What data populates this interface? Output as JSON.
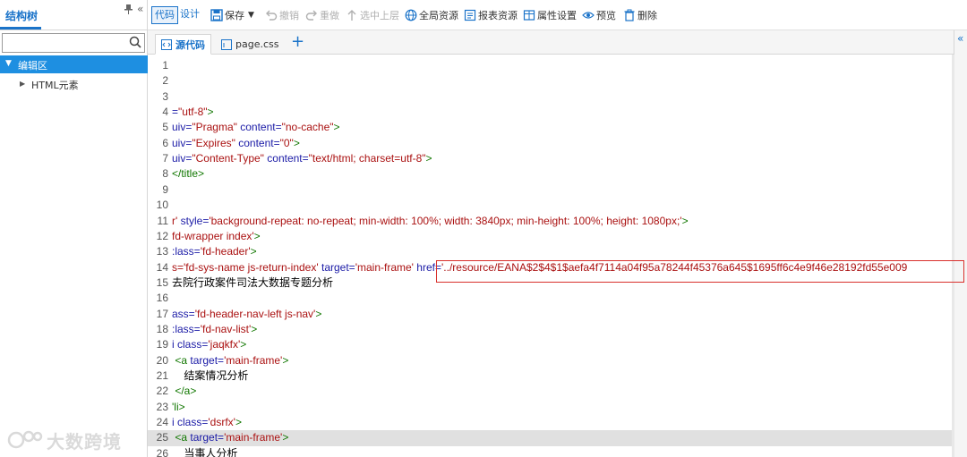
{
  "left_panel": {
    "title": "结构树",
    "pin_icon": "pin-icon",
    "collapse_icon": "double-chevron-left-icon",
    "search": {
      "value": "",
      "placeholder": ""
    },
    "tree": {
      "root": "编辑区",
      "child": "HTML元素"
    }
  },
  "toolbar": {
    "mode_code": "代码",
    "mode_design": "设计",
    "save": "保存",
    "undo": "撤销",
    "redo": "重做",
    "select_parent": "选中上层",
    "global_resources": "全局资源",
    "report_resources": "报表资源",
    "property_settings": "属性设置",
    "preview": "预览",
    "delete": "删除"
  },
  "tabs": [
    {
      "label": "源代码",
      "active": true
    },
    {
      "label": "page.css",
      "active": false
    }
  ],
  "editor": {
    "highlighted_line": 25,
    "lines": [
      {
        "n": "1",
        "segs": []
      },
      {
        "n": "2",
        "segs": []
      },
      {
        "n": "3",
        "segs": []
      },
      {
        "n": "4",
        "segs": [
          [
            "attr",
            "="
          ],
          [
            "str",
            "\"utf-8\""
          ],
          [
            "tag",
            ">"
          ]
        ]
      },
      {
        "n": "5",
        "segs": [
          [
            "attr",
            "uiv="
          ],
          [
            "str",
            "\"Pragma\""
          ],
          [
            "plain",
            " "
          ],
          [
            "attr",
            "content="
          ],
          [
            "str",
            "\"no-cache\""
          ],
          [
            "tag",
            ">"
          ]
        ]
      },
      {
        "n": "6",
        "segs": [
          [
            "attr",
            "uiv="
          ],
          [
            "str",
            "\"Expires\""
          ],
          [
            "plain",
            " "
          ],
          [
            "attr",
            "content="
          ],
          [
            "str",
            "\"0\""
          ],
          [
            "tag",
            ">"
          ]
        ]
      },
      {
        "n": "7",
        "segs": [
          [
            "attr",
            "uiv="
          ],
          [
            "str",
            "\"Content-Type\""
          ],
          [
            "plain",
            " "
          ],
          [
            "attr",
            "content="
          ],
          [
            "str",
            "\"text/html; charset=utf-8\""
          ],
          [
            "tag",
            ">"
          ]
        ]
      },
      {
        "n": "8",
        "segs": [
          [
            "tag",
            "</title>"
          ]
        ]
      },
      {
        "n": "9",
        "segs": []
      },
      {
        "n": "10",
        "segs": []
      },
      {
        "n": "11",
        "segs": [
          [
            "str",
            "r'"
          ],
          [
            "plain",
            " "
          ],
          [
            "attr",
            "style="
          ],
          [
            "str",
            "'background-repeat: no-repeat; min-width: 100%; width: 3840px; min-height: 100%; height: 1080px;'"
          ],
          [
            "tag",
            ">"
          ]
        ]
      },
      {
        "n": "12",
        "segs": [
          [
            "str",
            "fd-wrapper index'"
          ],
          [
            "tag",
            ">"
          ]
        ]
      },
      {
        "n": "13",
        "segs": [
          [
            "attr",
            ":lass="
          ],
          [
            "str",
            "'fd-header'"
          ],
          [
            "tag",
            ">"
          ]
        ]
      },
      {
        "n": "14",
        "segs": [
          [
            "str",
            "s='fd-sys-name js-return-index'"
          ],
          [
            "plain",
            " "
          ],
          [
            "attr",
            "target="
          ],
          [
            "str",
            "'main-frame'"
          ],
          [
            "plain",
            " "
          ],
          [
            "attr",
            "href="
          ],
          [
            "str",
            "'../resource/EANA$2$4$1$aefa4f7114a04f95a78244f45376a645$1695ff6c4e9f46e28192fd55e009"
          ]
        ]
      },
      {
        "n": "15",
        "segs": [
          [
            "plain",
            "去院行政案件司法大数据专题分析"
          ]
        ]
      },
      {
        "n": "16",
        "segs": []
      },
      {
        "n": "17",
        "segs": [
          [
            "attr",
            "ass="
          ],
          [
            "str",
            "'fd-header-nav-left js-nav'"
          ],
          [
            "tag",
            ">"
          ]
        ]
      },
      {
        "n": "18",
        "segs": [
          [
            "attr",
            ":lass="
          ],
          [
            "str",
            "'fd-nav-list'"
          ],
          [
            "tag",
            ">"
          ]
        ]
      },
      {
        "n": "19",
        "segs": [
          [
            "attr",
            "i class="
          ],
          [
            "str",
            "'jaqkfx'"
          ],
          [
            "tag",
            ">"
          ]
        ]
      },
      {
        "n": "20",
        "segs": [
          [
            "tag",
            " <a"
          ],
          [
            "plain",
            " "
          ],
          [
            "attr",
            "target="
          ],
          [
            "str",
            "'main-frame'"
          ],
          [
            "tag",
            ">"
          ]
        ]
      },
      {
        "n": "21",
        "segs": [
          [
            "plain",
            "    结案情况分析"
          ]
        ]
      },
      {
        "n": "22",
        "segs": [
          [
            "tag",
            " </a>"
          ]
        ]
      },
      {
        "n": "23",
        "segs": [
          [
            "tag",
            "'li>"
          ]
        ]
      },
      {
        "n": "24",
        "segs": [
          [
            "attr",
            "i class="
          ],
          [
            "str",
            "'dsrfx'"
          ],
          [
            "tag",
            ">"
          ]
        ]
      },
      {
        "n": "25",
        "segs": [
          [
            "tag",
            " <a"
          ],
          [
            "plain",
            " "
          ],
          [
            "attr",
            "target="
          ],
          [
            "str",
            "'main-frame'"
          ],
          [
            "tag",
            ">"
          ]
        ]
      },
      {
        "n": "26",
        "segs": [
          [
            "plain",
            "    当事人分析"
          ]
        ]
      }
    ]
  },
  "watermark": "大数跨境",
  "colors": {
    "accent": "#1a73c9",
    "tree_selected": "#1e8fe1",
    "highlight_box": "#d9302c",
    "line_highlight": "#e0e0e0"
  }
}
